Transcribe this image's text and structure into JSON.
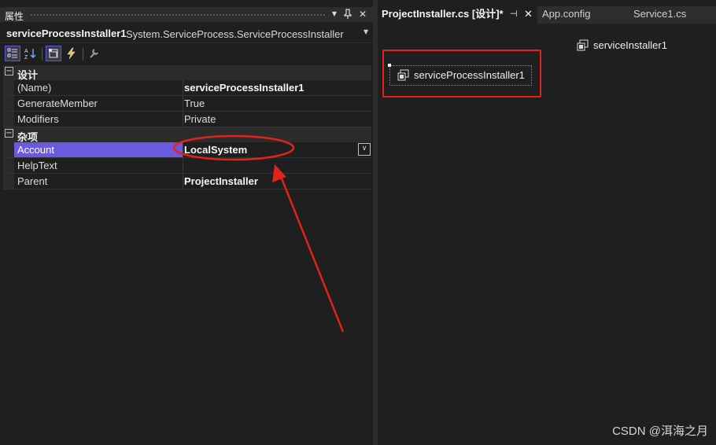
{
  "properties_panel": {
    "title": "属性",
    "title_buttons": {
      "dropdown": "▼",
      "pin": "⊥",
      "close": "✕"
    },
    "object_name": "serviceProcessInstaller1",
    "object_type": "System.ServiceProcess.ServiceProcessInstaller",
    "toolbar_icons": [
      "categorized-icon",
      "alphabetical-icon",
      "properties-icon",
      "events-icon",
      "property-pages-icon"
    ],
    "categories": [
      {
        "label": "设计",
        "rows": [
          {
            "name": "(Name)",
            "value": "serviceProcessInstaller1",
            "bold": true
          },
          {
            "name": "GenerateMember",
            "value": "True",
            "bold": false
          },
          {
            "name": "Modifiers",
            "value": "Private",
            "bold": false
          }
        ]
      },
      {
        "label": "杂项",
        "rows": [
          {
            "name": "Account",
            "value": "LocalSystem",
            "bold": true,
            "selected": true
          },
          {
            "name": "HelpText",
            "value": "",
            "bold": false
          },
          {
            "name": "Parent",
            "value": "ProjectInstaller",
            "bold": true
          }
        ]
      }
    ]
  },
  "document_tabs": [
    {
      "label": "ProjectInstaller.cs [设计]*",
      "active": true
    },
    {
      "label": "App.config",
      "active": false
    },
    {
      "label": "Service1.cs",
      "active": false
    }
  ],
  "designer": {
    "components": [
      "serviceInstaller1",
      "serviceProcessInstaller1"
    ]
  },
  "watermark": "CSDN @洱海之月",
  "colors": {
    "selection": "#6a5ae0",
    "annotation": "#e0231b",
    "background": "#1f1f1f"
  }
}
